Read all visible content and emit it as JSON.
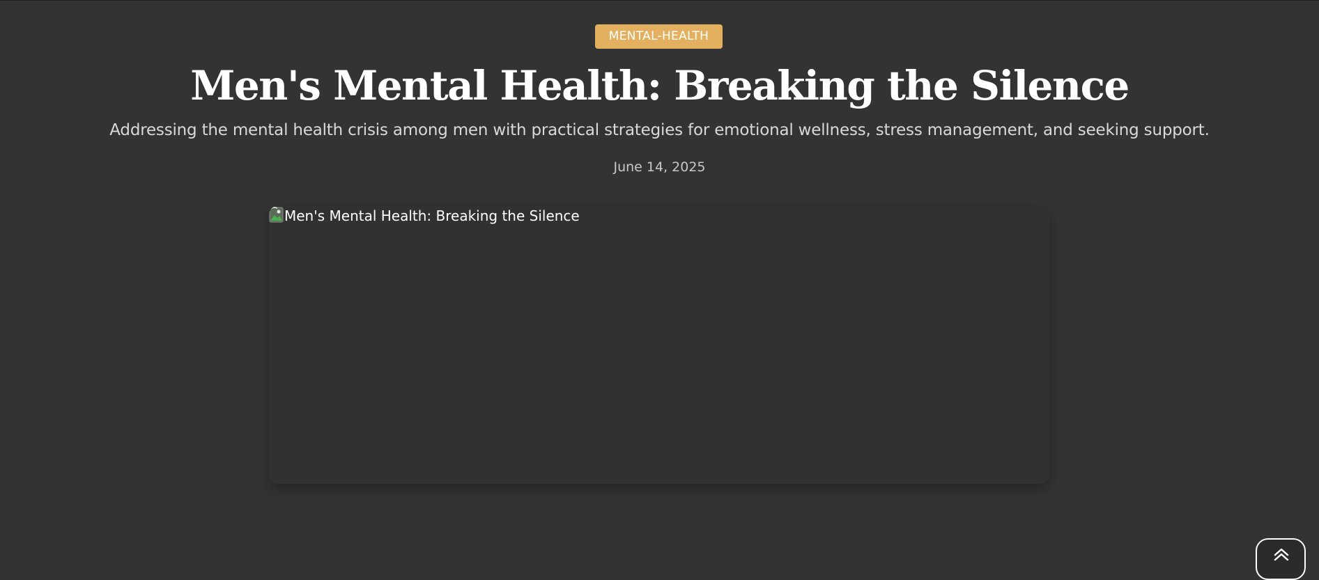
{
  "article": {
    "category": "MENTAL-HEALTH",
    "title": "Men's Mental Health: Breaking the Silence",
    "subtitle": "Addressing the mental health crisis among men with practical strategies for emotional wellness, stress management, and seeking support.",
    "date": "June 14, 2025",
    "hero_image": {
      "alt": "Men's Mental Health: Breaking the Silence",
      "icon": "broken-image-icon"
    }
  },
  "scroll_top": {
    "icon": "double-chevron-up-icon"
  },
  "colors": {
    "background": "#333333",
    "badge": "#e2b05e",
    "title": "#ffffff",
    "subtitle": "#d9d9d9",
    "date": "#c8c8c8"
  }
}
